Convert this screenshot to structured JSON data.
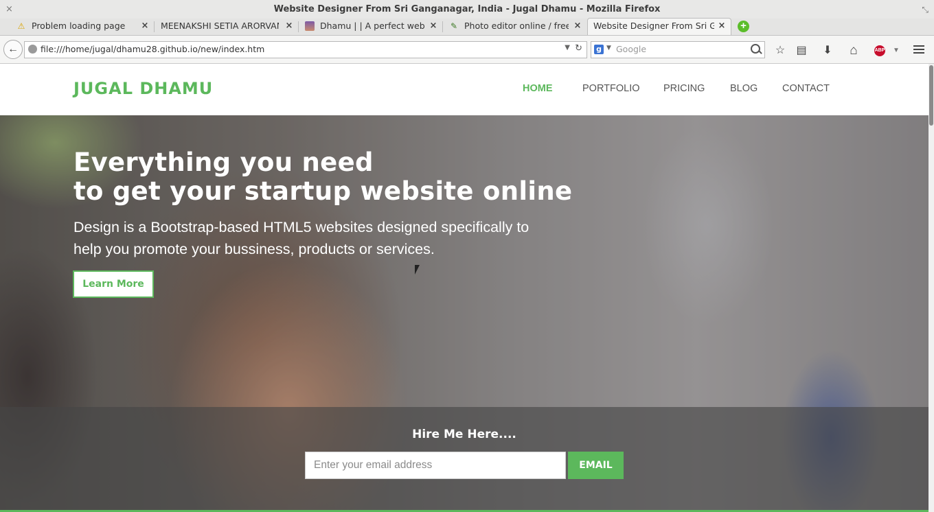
{
  "window": {
    "title": "Website Designer From Sri Ganganagar, India - Jugal Dhamu - Mozilla Firefox",
    "close_glyph": "×",
    "restore_glyph": "⤡"
  },
  "tabs": [
    {
      "label": "Problem loading page",
      "icon": "warning-icon",
      "icon_glyph": "⚠"
    },
    {
      "label": "MEENAKSHI SETIA ARORVANS...",
      "icon": "none"
    },
    {
      "label": "Dhamu | | A perfect web d...",
      "icon": "favicon-avatar-icon"
    },
    {
      "label": "Photo editor online / free i...",
      "icon": "pencil-icon",
      "icon_glyph": "✎"
    },
    {
      "label": "Website Designer From Sri Gan...",
      "icon": "none",
      "active": true
    }
  ],
  "tab_close_glyph": "×",
  "new_tab_glyph": "+",
  "toolbar": {
    "back_glyph": "←",
    "url": "file:///home/jugal/dhamu28.github.io/new/index.htm",
    "url_dropdown_glyph": "▼",
    "reload_glyph": "↻",
    "search_engine_glyph": "g",
    "search_dropdown_glyph": "▼",
    "search_placeholder": "Google",
    "bookmark_glyph": "☆",
    "reader_glyph": "▤",
    "download_glyph": "⬇",
    "home_glyph": "⌂",
    "abp_label": "ABP",
    "abp_dropdown_glyph": "▼"
  },
  "site": {
    "logo": "JUGAL DHAMU",
    "nav": [
      {
        "label": "HOME",
        "active": true
      },
      {
        "label": "PORTFOLIO"
      },
      {
        "label": "PRICING"
      },
      {
        "label": "BLOG"
      },
      {
        "label": "CONTACT"
      }
    ],
    "hero": {
      "title_line1": "Everything you need",
      "title_line2": "to get your startup website online",
      "subtitle": "Design is a Bootstrap-based HTML5 websites designed specifically to help you promote your bussiness, products or services.",
      "cta_label": "Learn More"
    },
    "hire": {
      "title": "Hire Me Here....",
      "email_placeholder": "Enter your email address",
      "button_label": "EMAIL"
    }
  },
  "colors": {
    "accent": "#5cb85c",
    "nav_text": "#555555",
    "chrome_bg": "#e8e8e7"
  }
}
